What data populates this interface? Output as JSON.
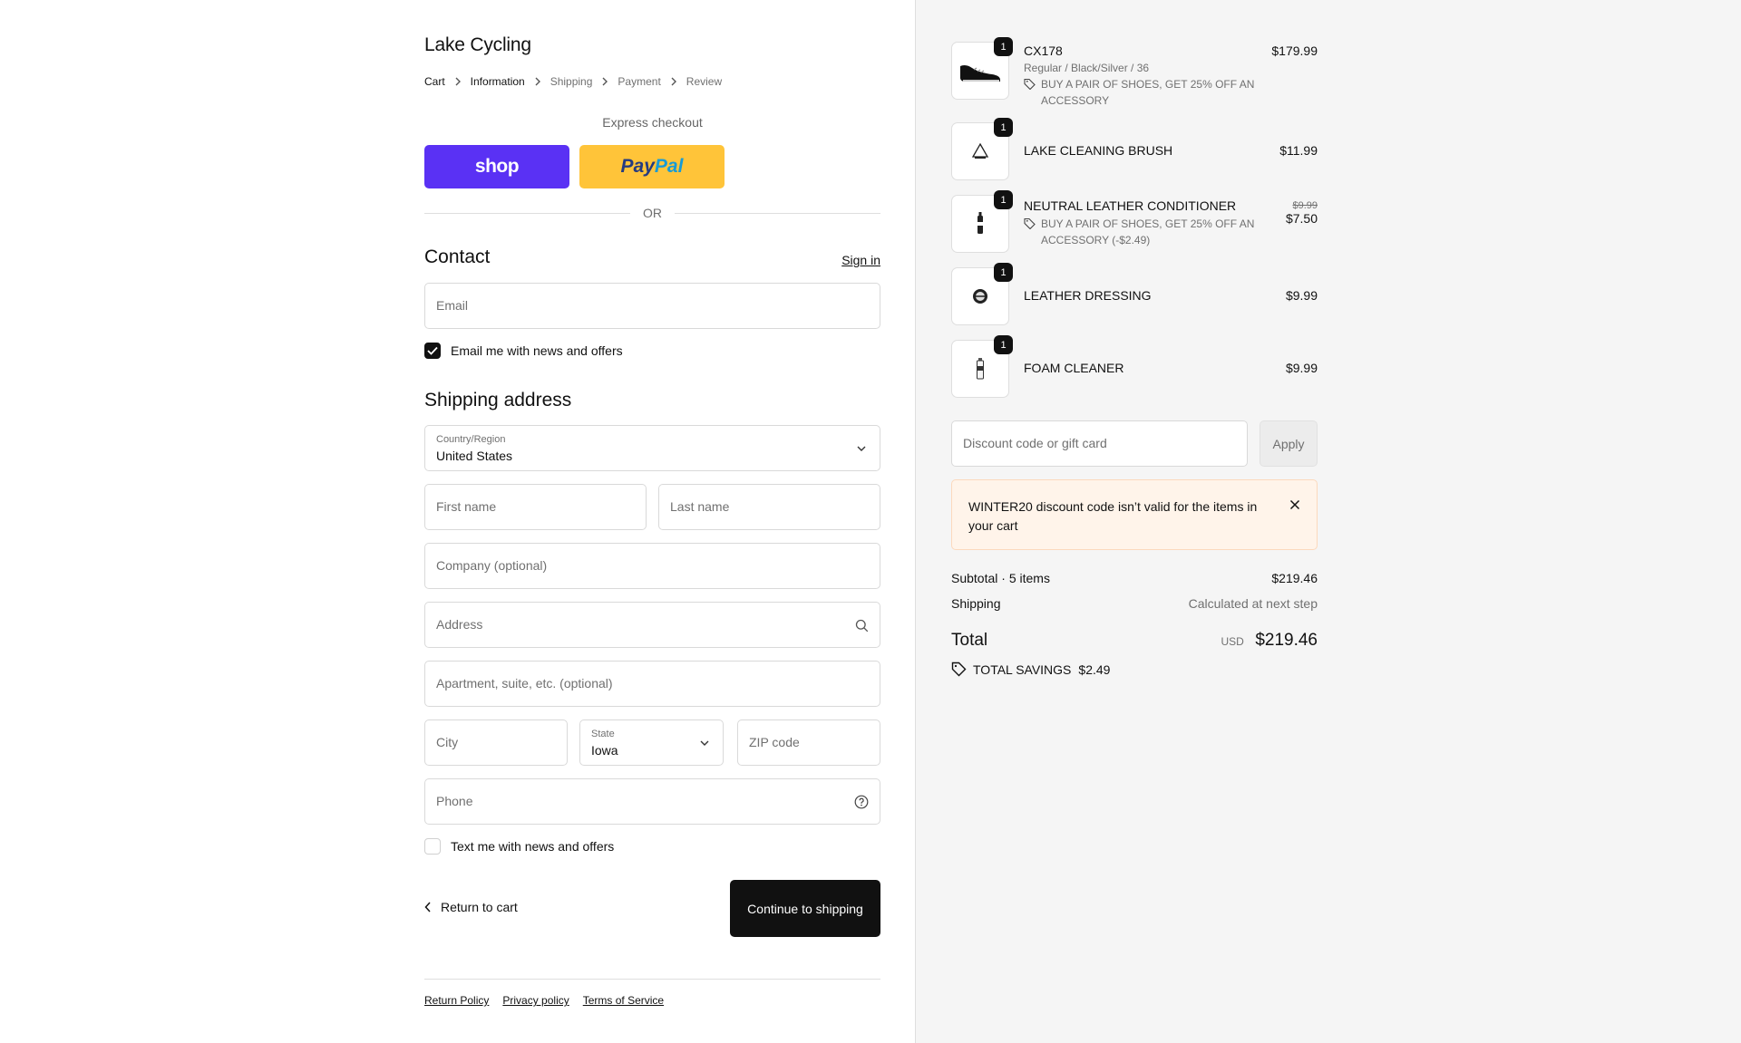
{
  "store": {
    "title": "Lake Cycling"
  },
  "breadcrumb": [
    "Cart",
    "Information",
    "Shipping",
    "Payment",
    "Review"
  ],
  "express": {
    "label": "Express checkout",
    "shop_label": "shop",
    "paypal_a": "Pay",
    "paypal_b": "Pal"
  },
  "or_label": "OR",
  "contact": {
    "heading": "Contact",
    "signin": "Sign in",
    "email_placeholder": "Email",
    "email_optin": "Email me with news and offers",
    "email_optin_checked": true
  },
  "shipping": {
    "heading": "Shipping address",
    "country_label": "Country/Region",
    "country_value": "United States",
    "first_name": "First name",
    "last_name": "Last name",
    "company": "Company (optional)",
    "address": "Address",
    "apartment": "Apartment, suite, etc. (optional)",
    "city": "City",
    "state_label": "State",
    "state_value": "Iowa",
    "zip": "ZIP code",
    "phone": "Phone",
    "sms_optin": "Text me with news and offers",
    "sms_optin_checked": false
  },
  "actions": {
    "return": "Return to cart",
    "continue": "Continue to shipping"
  },
  "footer": [
    "Return Policy",
    "Privacy policy",
    "Terms of Service"
  ],
  "cart": {
    "items": [
      {
        "name": "CX178",
        "variant": "Regular / Black/Silver / 36",
        "discount": "BUY A PAIR OF SHOES, GET 25% OFF AN ACCESSORY",
        "price": "$179.99",
        "old_price": "",
        "qty": "1",
        "icon": "shoe-icon"
      },
      {
        "name": "LAKE CLEANING BRUSH",
        "variant": "",
        "discount": "",
        "price": "$11.99",
        "old_price": "",
        "qty": "1",
        "icon": "brush-icon"
      },
      {
        "name": "NEUTRAL LEATHER CONDITIONER",
        "variant": "",
        "discount": "BUY A PAIR OF SHOES, GET 25% OFF AN ACCESSORY (-$2.49)",
        "price": "$7.50",
        "old_price": "$9.99",
        "qty": "1",
        "icon": "bottle-icon"
      },
      {
        "name": "LEATHER DRESSING",
        "variant": "",
        "discount": "",
        "price": "$9.99",
        "old_price": "",
        "qty": "1",
        "icon": "tin-icon"
      },
      {
        "name": "FOAM CLEANER",
        "variant": "",
        "discount": "",
        "price": "$9.99",
        "old_price": "",
        "qty": "1",
        "icon": "can-icon"
      }
    ],
    "discount_placeholder": "Discount code or gift card",
    "apply": "Apply",
    "alert": "WINTER20 discount code isn’t valid for the items in your cart",
    "subtotal_label": "Subtotal · 5 items",
    "subtotal_value": "$219.46",
    "shipping_label": "Shipping",
    "shipping_value": "Calculated at next step",
    "total_label": "Total",
    "currency": "USD",
    "total_value": "$219.46",
    "savings_label": "TOTAL SAVINGS",
    "savings_value": "$2.49"
  },
  "colors": {
    "shop": "#5a31f4",
    "paypal": "#ffc439",
    "alert_bg": "#fff4ea",
    "primary": "#111111"
  }
}
